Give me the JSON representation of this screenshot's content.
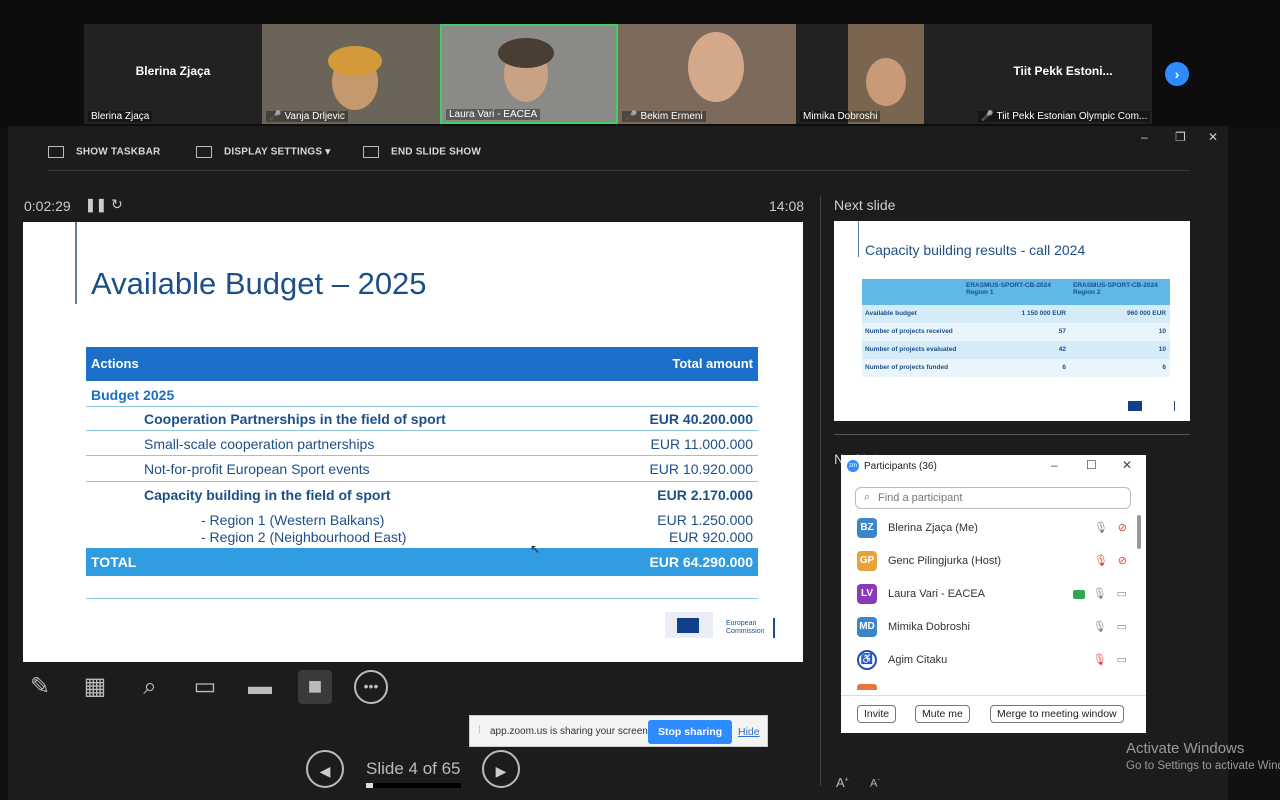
{
  "video_strip": {
    "tiles": [
      {
        "name": "Blerina Zjaça",
        "big_name": "Blerina Zjaça",
        "muted": false
      },
      {
        "name": "Vanja Drljevic",
        "muted": true
      },
      {
        "name": "Laura Vari - EACEA",
        "muted": false,
        "active": true
      },
      {
        "name": "Bekim Ermeni",
        "muted": true
      },
      {
        "name": "Mimika Dobroshi",
        "muted": false
      },
      {
        "name": "Tiit Pekk Estonian Olympic Com...",
        "big_name": "Tiit Pekk Estoni...",
        "muted": true
      }
    ],
    "next_icon": "chevron-right-icon"
  },
  "toolbar": {
    "show_taskbar": "SHOW TASKBAR",
    "display_settings": "DISPLAY SETTINGS ▾",
    "end_slide_show": "END SLIDE SHOW"
  },
  "presenter": {
    "elapsed": "0:02:29",
    "clock": "14:08",
    "next_slide_label": "Next slide",
    "notes_label": "No Notes",
    "slide_counter": "Slide 4 of 65"
  },
  "slide": {
    "title": "Available Budget – 2025",
    "header": {
      "actions": "Actions",
      "total": "Total amount"
    },
    "section": "Budget 2025",
    "rows": [
      {
        "label": "Cooperation Partnerships in the field of sport",
        "amount": "EUR 40.200.000",
        "bold": true
      },
      {
        "label": "Small-scale cooperation partnerships",
        "amount": "EUR 11.000.000",
        "bold": false
      },
      {
        "label": "Not-for-profit European Sport events",
        "amount": "EUR 10.920.000",
        "bold": false
      },
      {
        "label": "Capacity building in the field of sport",
        "amount": "EUR 2.170.000",
        "bold": true
      },
      {
        "label": "- Region 1 (Western Balkans)",
        "amount": "EUR 1.250.000",
        "bold": false
      },
      {
        "label": "- Region 2 (Neighbourhood East)",
        "amount": "EUR 920.000",
        "bold": false
      }
    ],
    "total": {
      "label": "TOTAL",
      "amount": "EUR 64.290.000"
    },
    "logo_text": "European Commission"
  },
  "next_slide": {
    "title": "Capacity building results - call 2024",
    "col1": "ERASMUS-SPORT-CB-2024 Region 1",
    "col2": "ERASMUS-SPORT-CB-2024 Region 2",
    "rows": [
      {
        "label": "Available budget",
        "r1": "1 150 000 EUR",
        "r2": "960 000 EUR"
      },
      {
        "label": "Number of projects received",
        "r1": "57",
        "r2": "10"
      },
      {
        "label": "Number of projects evaluated",
        "r1": "42",
        "r2": "10"
      },
      {
        "label": "Number of projects funded",
        "r1": "6",
        "r2": "6"
      }
    ]
  },
  "participants": {
    "title": "Participants (36)",
    "search_placeholder": "Find a participant",
    "list": [
      {
        "initials": "BZ",
        "name": "Blerina Zjaça (Me)",
        "color": "#3a86c8"
      },
      {
        "initials": "GP",
        "name": "Genc Pilingjurka (Host)",
        "color": "#e8a23a"
      },
      {
        "initials": "LV",
        "name": "Laura Vari - EACEA",
        "color": "#8a3ab8"
      },
      {
        "initials": "MD",
        "name": "Mimika Dobroshi",
        "color": "#3a86c8"
      },
      {
        "initials": "",
        "name": "Agim Citaku",
        "color": "#2a4fa8"
      }
    ],
    "invite": "Invite",
    "mute_me": "Mute me",
    "merge": "Merge to meeting window"
  },
  "share_bar": {
    "text": "app.zoom.us is sharing your screen.",
    "stop": "Stop sharing",
    "hide": "Hide"
  },
  "activate": {
    "title": "Activate Windows",
    "sub": "Go to Settings to activate Windows."
  }
}
